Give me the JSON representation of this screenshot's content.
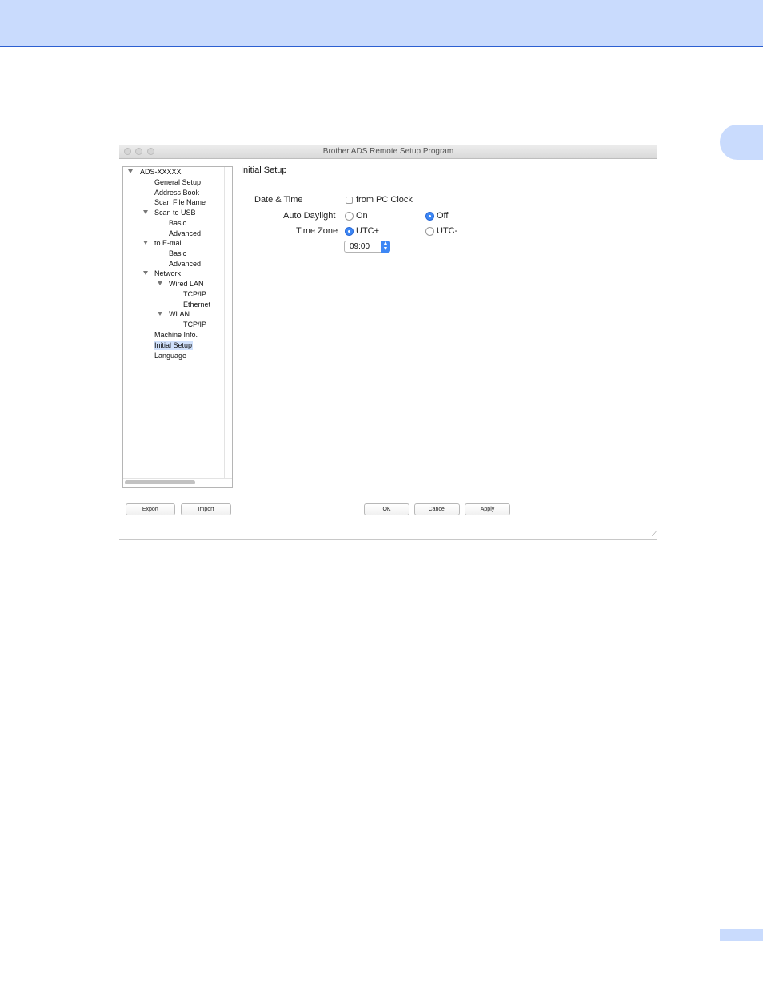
{
  "window": {
    "title": "Brother ADS Remote Setup Program"
  },
  "tree": {
    "items": [
      {
        "label": "ADS-XXXXX"
      },
      {
        "label": "General Setup"
      },
      {
        "label": "Address Book"
      },
      {
        "label": "Scan File Name"
      },
      {
        "label": "Scan to USB"
      },
      {
        "label": "Basic"
      },
      {
        "label": "Advanced"
      },
      {
        "label": "to E-mail"
      },
      {
        "label": "Basic"
      },
      {
        "label": "Advanced"
      },
      {
        "label": "Network"
      },
      {
        "label": "Wired LAN"
      },
      {
        "label": "TCP/IP"
      },
      {
        "label": "Ethernet"
      },
      {
        "label": "WLAN"
      },
      {
        "label": "TCP/IP"
      },
      {
        "label": "Machine Info."
      },
      {
        "label": "Initial Setup"
      },
      {
        "label": "Language"
      }
    ]
  },
  "panel": {
    "title": "Initial Setup",
    "date_time": {
      "label": "Date & Time",
      "checkbox_label": "from PC Clock"
    },
    "auto_daylight": {
      "label": "Auto Daylight",
      "on_label": "On",
      "off_label": "Off",
      "selected": "Off"
    },
    "time_zone": {
      "label": "Time Zone",
      "plus_label": "UTC+",
      "minus_label": "UTC-",
      "selected": "UTC+",
      "value": "09:00"
    }
  },
  "buttons": {
    "export": "Export",
    "import": "Import",
    "ok": "OK",
    "cancel": "Cancel",
    "apply": "Apply"
  }
}
